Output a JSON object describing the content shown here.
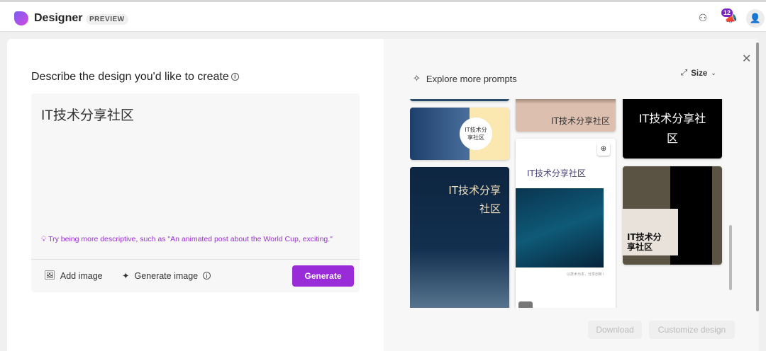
{
  "app": {
    "name": "Designer",
    "badge": "PREVIEW",
    "notification_count": "12"
  },
  "left": {
    "title": "Describe the design you'd like to create",
    "prompt_value": "IT技术分享社区",
    "hint": "Try being more descriptive, such as \"An animated post about the World Cup, exciting.\"",
    "add_image": "Add image",
    "generate_image": "Generate image",
    "generate": "Generate"
  },
  "right": {
    "explore": "Explore more prompts",
    "size": "Size",
    "download": "Download",
    "customize": "Customize design",
    "cards": {
      "c1": "IT技术分\n享社区",
      "c2": "IT技术分享\n社区",
      "c3": "IT技术分享社区",
      "c4": "IT技术分享社区",
      "c4_caption": "以技术为本，分享创新！",
      "c5": "IT技术分享社\n区",
      "c6": "IT技术分\n享社区"
    }
  },
  "colors": {
    "accent": "#9a2bd8",
    "hint": "#9b30d9"
  }
}
